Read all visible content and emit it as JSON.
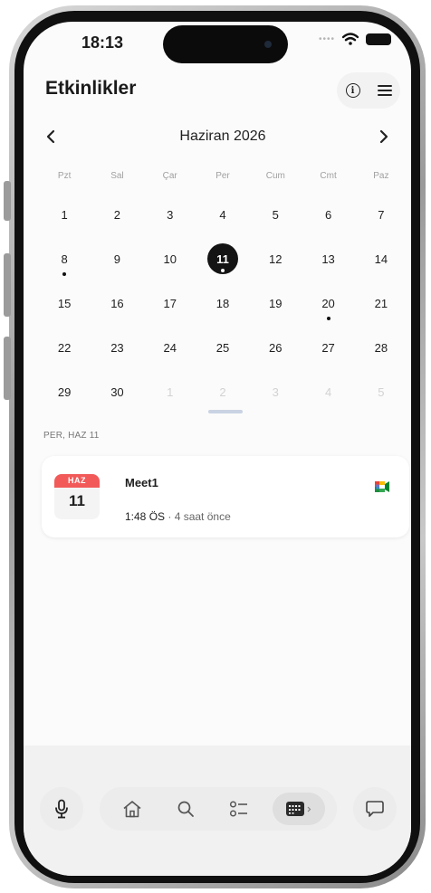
{
  "status_bar": {
    "time": "18:13"
  },
  "header": {
    "title": "Etkinlikler",
    "info_icon": "info-icon",
    "list_icon": "list-icon"
  },
  "calendar": {
    "month_label": "Haziran 2026",
    "prev_icon": "chevron-left-icon",
    "next_icon": "chevron-right-icon",
    "weekdays": [
      "Pzt",
      "Sal",
      "Çar",
      "Per",
      "Cum",
      "Cmt",
      "Paz"
    ],
    "days": [
      {
        "n": "1"
      },
      {
        "n": "2"
      },
      {
        "n": "3"
      },
      {
        "n": "4"
      },
      {
        "n": "5"
      },
      {
        "n": "6"
      },
      {
        "n": "7"
      },
      {
        "n": "8",
        "dot": true
      },
      {
        "n": "9"
      },
      {
        "n": "10"
      },
      {
        "n": "11",
        "selected": true,
        "dot": true
      },
      {
        "n": "12"
      },
      {
        "n": "13"
      },
      {
        "n": "14"
      },
      {
        "n": "15"
      },
      {
        "n": "16"
      },
      {
        "n": "17"
      },
      {
        "n": "18"
      },
      {
        "n": "19"
      },
      {
        "n": "20",
        "dot": true
      },
      {
        "n": "21"
      },
      {
        "n": "22"
      },
      {
        "n": "23"
      },
      {
        "n": "24"
      },
      {
        "n": "25"
      },
      {
        "n": "26"
      },
      {
        "n": "27"
      },
      {
        "n": "28"
      },
      {
        "n": "29"
      },
      {
        "n": "30"
      },
      {
        "n": "1",
        "muted": true
      },
      {
        "n": "2",
        "muted": true
      },
      {
        "n": "3",
        "muted": true
      },
      {
        "n": "4",
        "muted": true
      },
      {
        "n": "5",
        "muted": true
      }
    ],
    "selected_color": "#141414"
  },
  "events": {
    "section_label": "PER, HAZ 11",
    "items": [
      {
        "badge_month": "HAZ",
        "badge_day": "11",
        "title": "Meet1",
        "time": "1:48 ÖS",
        "separator": " · ",
        "relative": "4 saat önce",
        "app_icon": "google-meet-icon"
      }
    ]
  },
  "bottom_bar": {
    "mic_icon": "microphone-icon",
    "nav": [
      "home-icon",
      "search-icon",
      "checklist-icon",
      "calendar-icon"
    ],
    "active": "calendar-icon",
    "chat_icon": "chat-bubble-icon"
  },
  "colors": {
    "accent_badge": "#f25a5a",
    "background": "#fbfbfb"
  }
}
